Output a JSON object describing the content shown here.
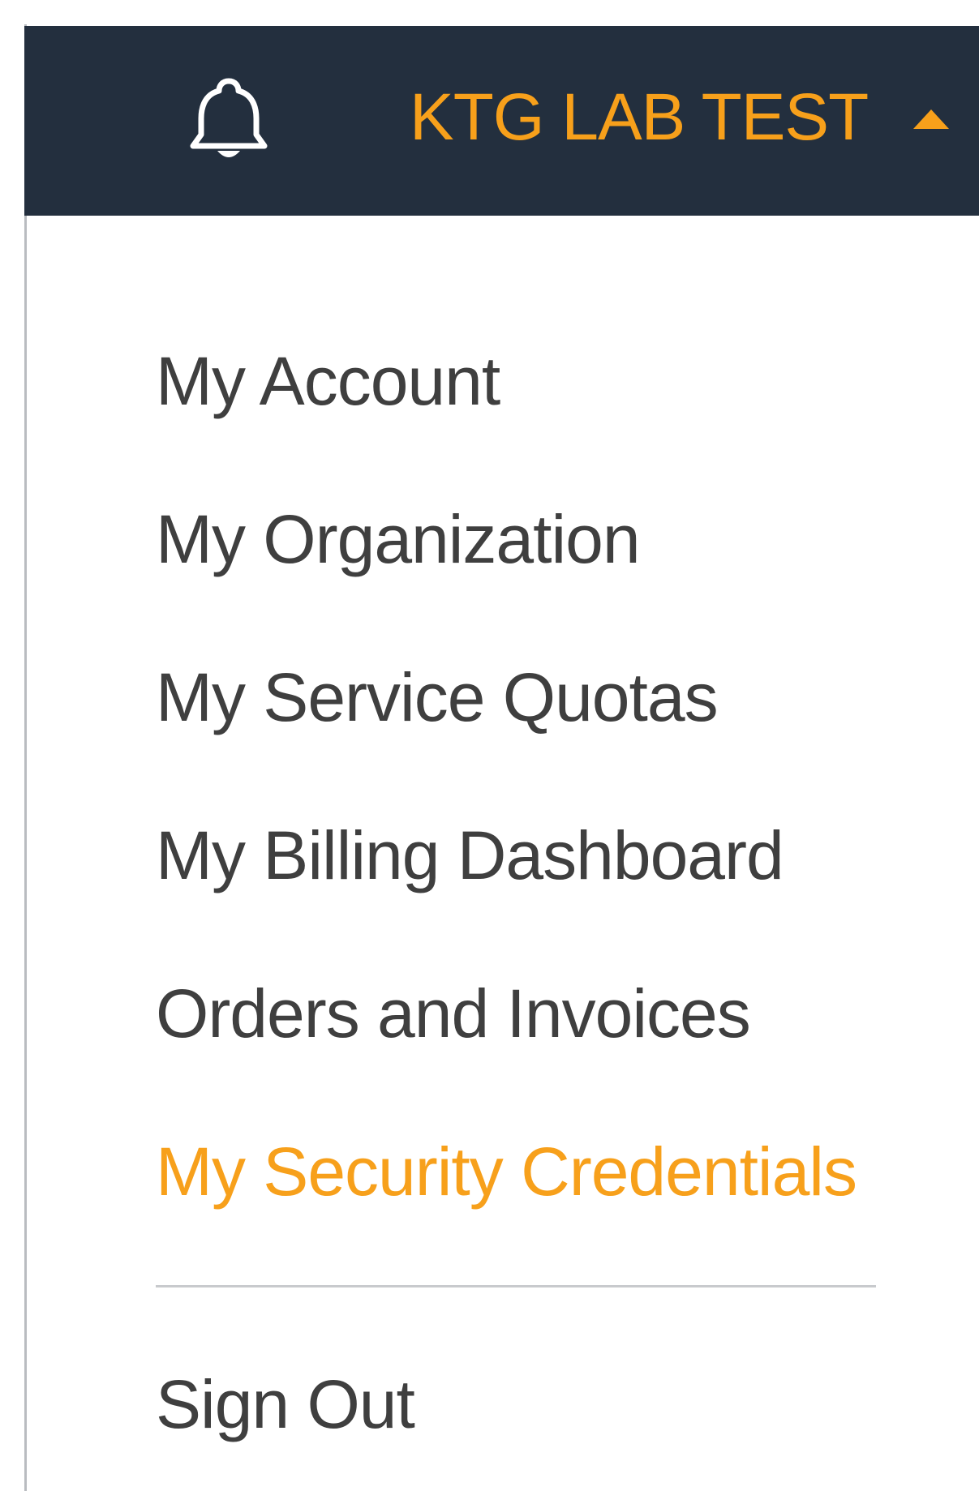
{
  "header": {
    "account_name": "KTG LAB TEST",
    "bell_icon": "bell-icon",
    "caret_icon": "caret-up-icon",
    "background_color": "#232f3e",
    "accent_color": "#f7a01b"
  },
  "menu": {
    "items": [
      {
        "label": "My Account"
      },
      {
        "label": "My Organization"
      },
      {
        "label": "My Service Quotas"
      },
      {
        "label": "My Billing Dashboard"
      },
      {
        "label": "Orders and Invoices"
      },
      {
        "label": "My Security Credentials",
        "active": true
      }
    ],
    "sign_out_label": "Sign Out",
    "text_color": "#3f3f3f",
    "active_color": "#f7a01b"
  }
}
